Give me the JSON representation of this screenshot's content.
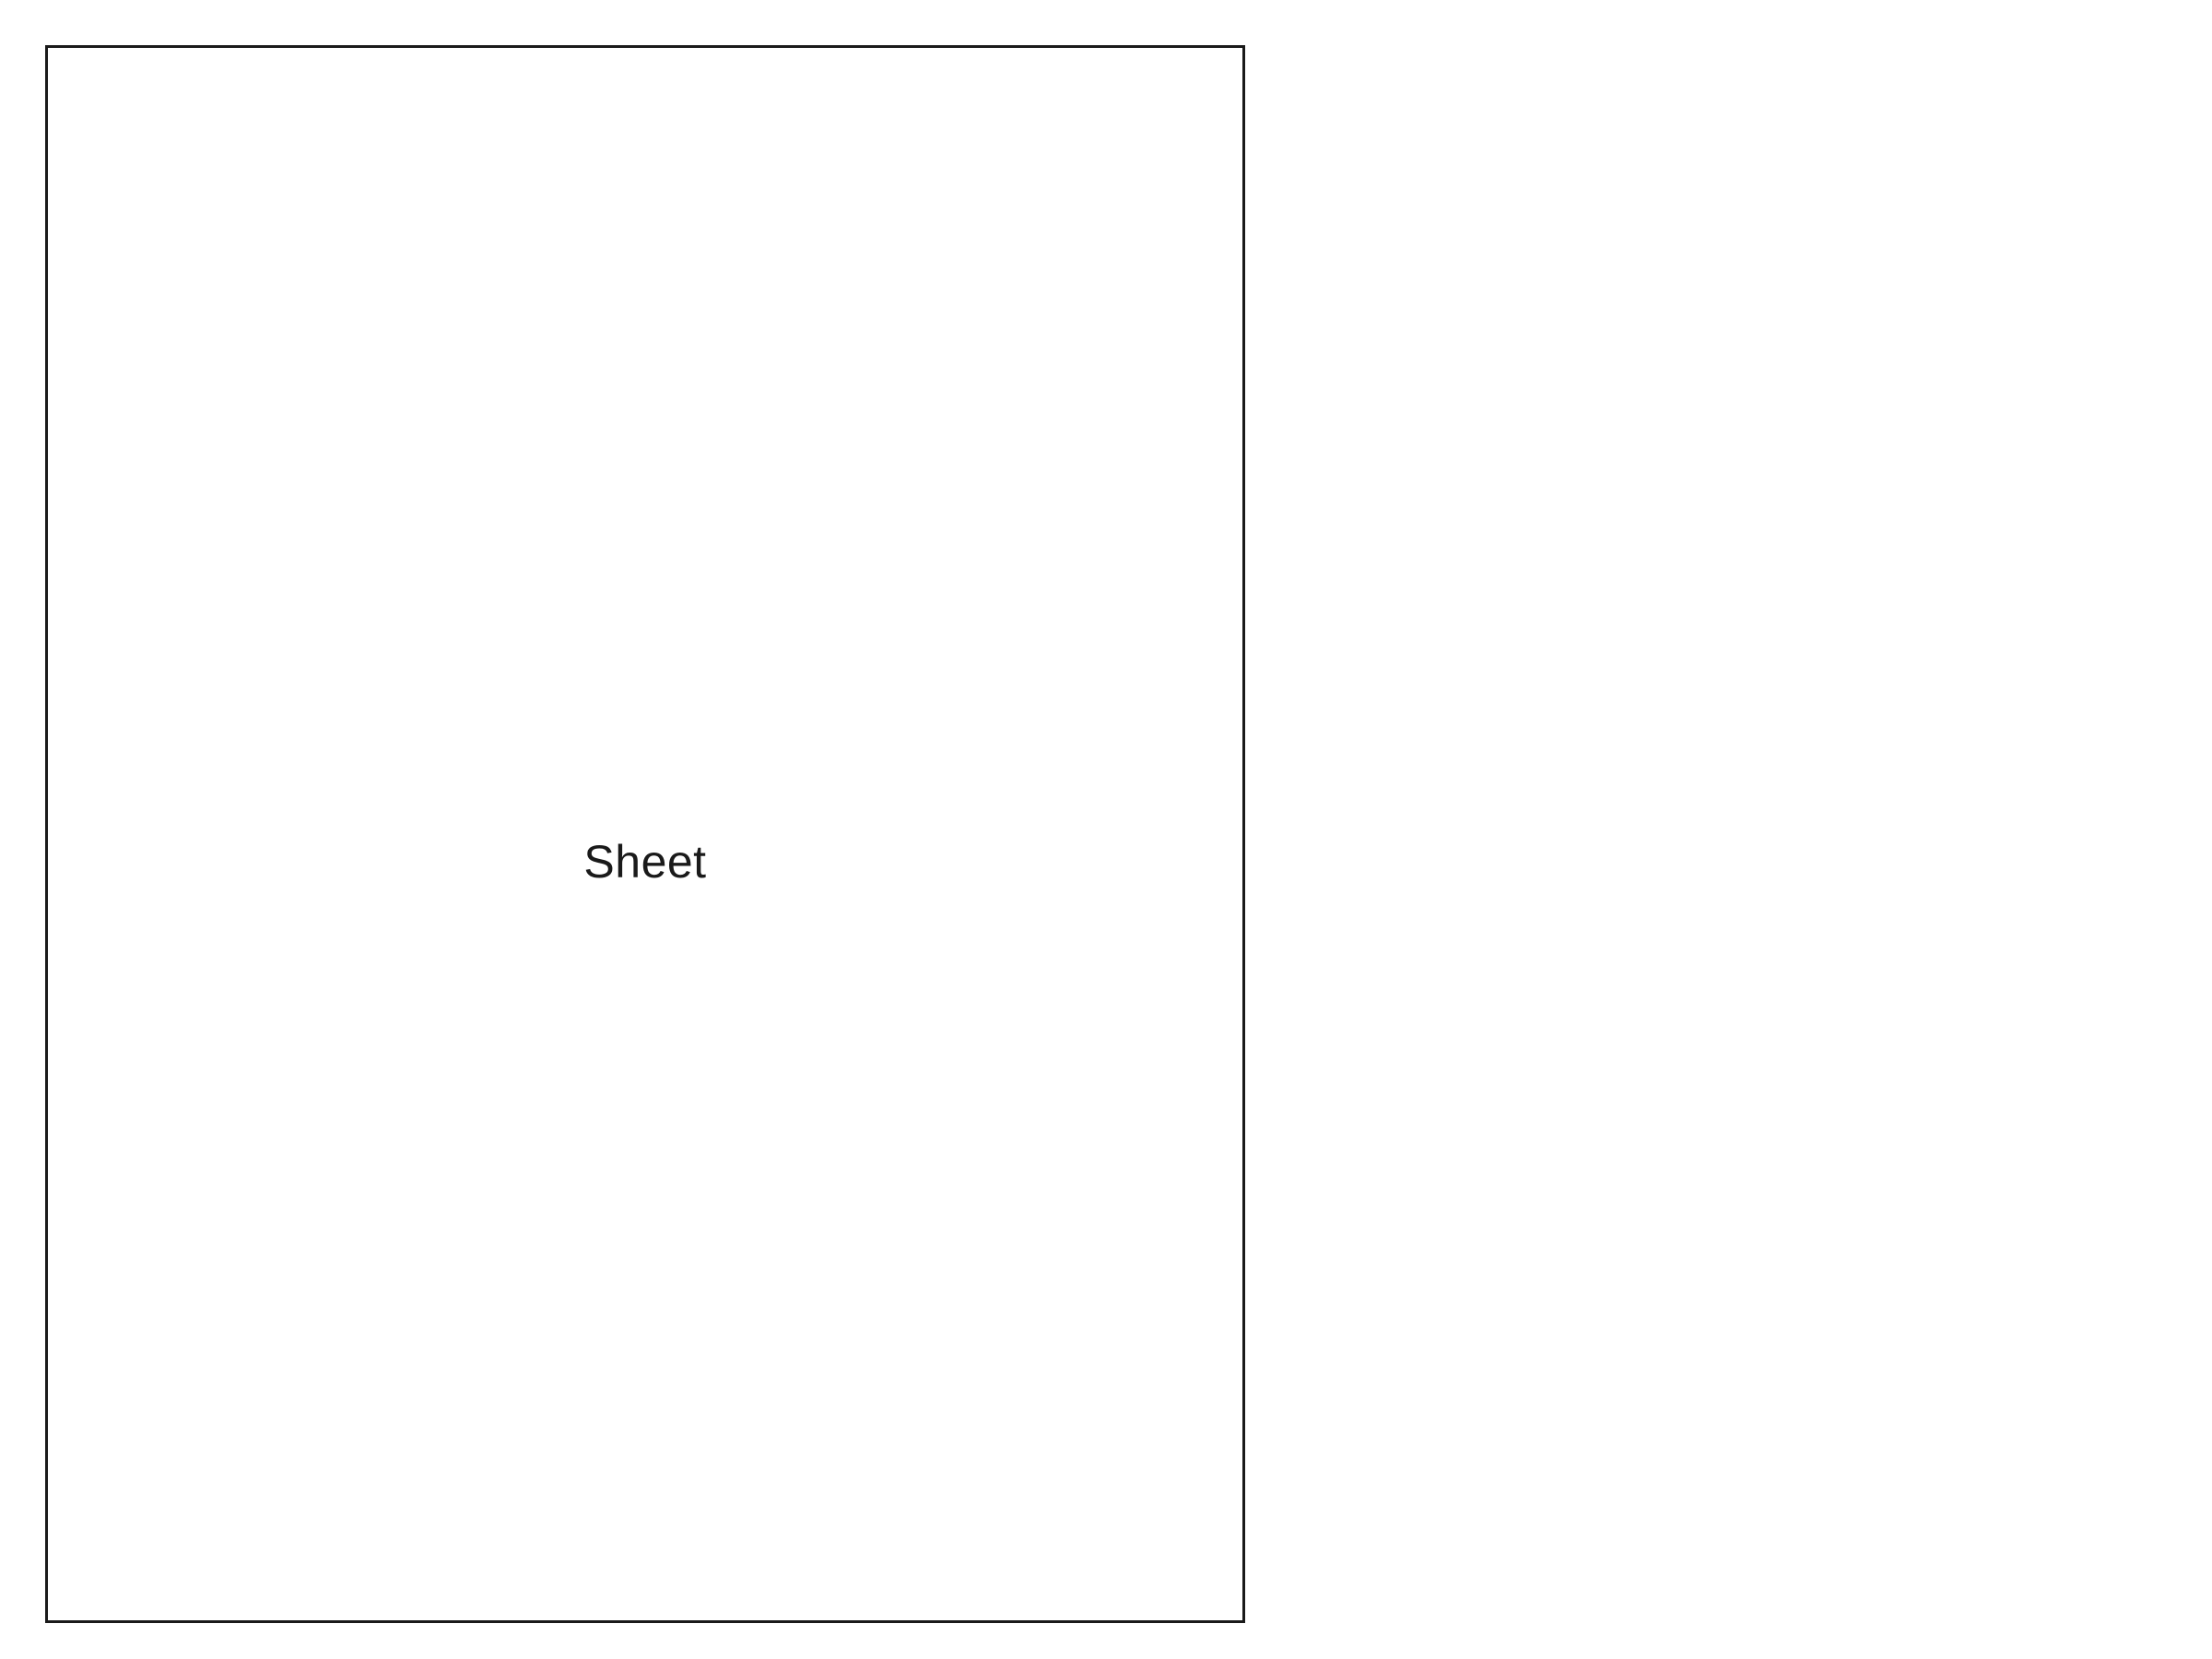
{
  "sheet": {
    "label": "Sheet"
  },
  "colors": {
    "background": "#ffffff",
    "border": "#1a1a1a",
    "text": "#1a1a1a"
  }
}
